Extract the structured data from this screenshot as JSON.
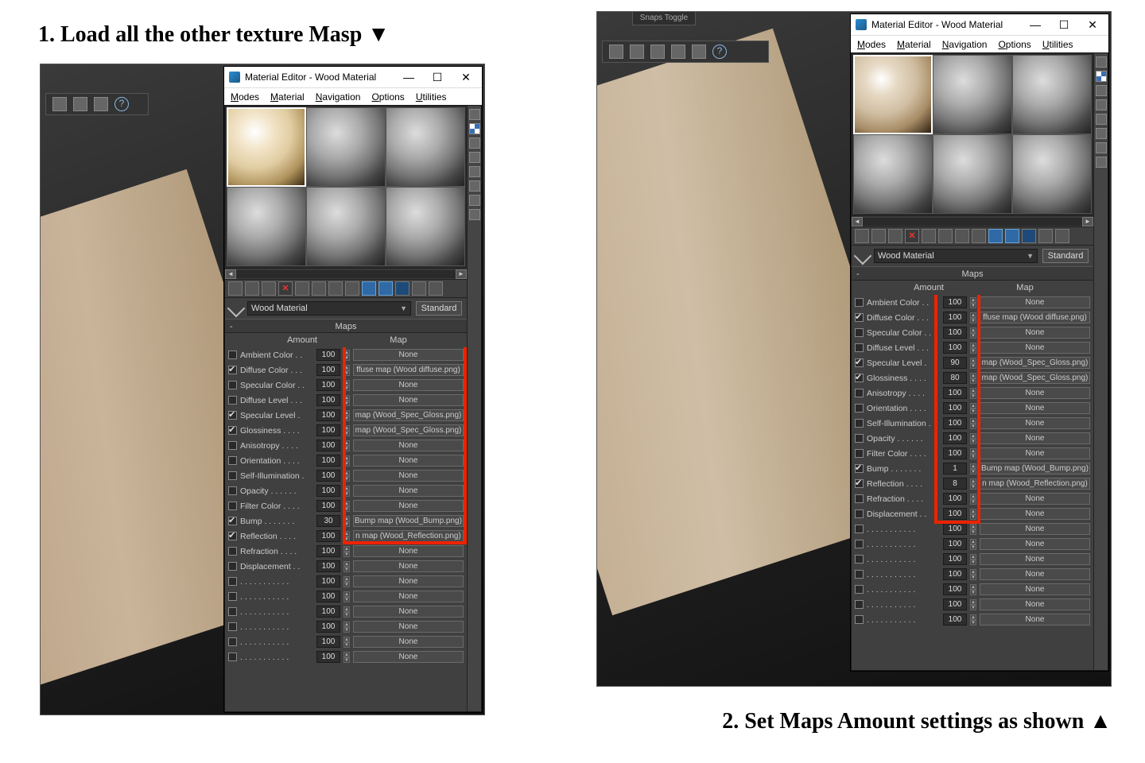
{
  "step1_label": "1. Load all the other texture Masp ▼",
  "step2_label": "2. Set Maps Amount settings as shown ▲",
  "snaps_label": "Snaps Toggle",
  "me_title": "Material Editor - Wood Material",
  "menu": {
    "modes": "Modes",
    "material": "Material",
    "navigation": "Navigation",
    "options": "Options",
    "utilities": "Utilities"
  },
  "material_name": "Wood Material",
  "shader_button": "Standard",
  "rollout_title": "Maps",
  "col_amount": "Amount",
  "col_map": "Map",
  "rows_left": [
    {
      "chk": false,
      "label": "Ambient Color . .",
      "amt": "100",
      "map": "None"
    },
    {
      "chk": true,
      "label": "Diffuse Color . . .",
      "amt": "100",
      "map": "ffuse map (Wood diffuse.png)"
    },
    {
      "chk": false,
      "label": "Specular Color . .",
      "amt": "100",
      "map": "None"
    },
    {
      "chk": false,
      "label": "Diffuse Level . . .",
      "amt": "100",
      "map": "None"
    },
    {
      "chk": true,
      "label": "Specular Level .",
      "amt": "100",
      "map": "map (Wood_Spec_Gloss.png)"
    },
    {
      "chk": true,
      "label": "Glossiness  . . . .",
      "amt": "100",
      "map": "map (Wood_Spec_Gloss.png)"
    },
    {
      "chk": false,
      "label": "Anisotropy . . . .",
      "amt": "100",
      "map": "None"
    },
    {
      "chk": false,
      "label": "Orientation . . . .",
      "amt": "100",
      "map": "None"
    },
    {
      "chk": false,
      "label": "Self-Illumination .",
      "amt": "100",
      "map": "None"
    },
    {
      "chk": false,
      "label": "Opacity . . . . . .",
      "amt": "100",
      "map": "None"
    },
    {
      "chk": false,
      "label": "Filter Color . . . .",
      "amt": "100",
      "map": "None"
    },
    {
      "chk": true,
      "label": "Bump . . . . . . .",
      "amt": "30",
      "map": "Bump map (Wood_Bump.png)"
    },
    {
      "chk": true,
      "label": "Reflection  . . . .",
      "amt": "100",
      "map": "n map (Wood_Reflection.png)"
    },
    {
      "chk": false,
      "label": "Refraction  . . . .",
      "amt": "100",
      "map": "None"
    },
    {
      "chk": false,
      "label": "Displacement  . .",
      "amt": "100",
      "map": "None"
    },
    {
      "chk": false,
      "label": " . . . . . . . . . . .",
      "amt": "100",
      "map": "None"
    },
    {
      "chk": false,
      "label": " . . . . . . . . . . .",
      "amt": "100",
      "map": "None"
    },
    {
      "chk": false,
      "label": " . . . . . . . . . . .",
      "amt": "100",
      "map": "None"
    },
    {
      "chk": false,
      "label": " . . . . . . . . . . .",
      "amt": "100",
      "map": "None"
    },
    {
      "chk": false,
      "label": " . . . . . . . . . . .",
      "amt": "100",
      "map": "None"
    },
    {
      "chk": false,
      "label": " . . . . . . . . . . .",
      "amt": "100",
      "map": "None"
    }
  ],
  "rows_right": [
    {
      "chk": false,
      "label": "Ambient Color . .",
      "amt": "100",
      "map": "None"
    },
    {
      "chk": true,
      "label": "Diffuse Color . . .",
      "amt": "100",
      "map": "ffuse map (Wood diffuse.png)"
    },
    {
      "chk": false,
      "label": "Specular Color . .",
      "amt": "100",
      "map": "None"
    },
    {
      "chk": false,
      "label": "Diffuse Level . . .",
      "amt": "100",
      "map": "None"
    },
    {
      "chk": true,
      "label": "Specular Level .",
      "amt": "90",
      "map": "map (Wood_Spec_Gloss.png)"
    },
    {
      "chk": true,
      "label": "Glossiness  . . . .",
      "amt": "80",
      "map": "map (Wood_Spec_Gloss.png)"
    },
    {
      "chk": false,
      "label": "Anisotropy . . . .",
      "amt": "100",
      "map": "None"
    },
    {
      "chk": false,
      "label": "Orientation . . . .",
      "amt": "100",
      "map": "None"
    },
    {
      "chk": false,
      "label": "Self-Illumination .",
      "amt": "100",
      "map": "None"
    },
    {
      "chk": false,
      "label": "Opacity . . . . . .",
      "amt": "100",
      "map": "None"
    },
    {
      "chk": false,
      "label": "Filter Color . . . .",
      "amt": "100",
      "map": "None"
    },
    {
      "chk": true,
      "label": "Bump . . . . . . .",
      "amt": "1",
      "map": "Bump map (Wood_Bump.png)"
    },
    {
      "chk": true,
      "label": "Reflection  . . . .",
      "amt": "8",
      "map": "n map (Wood_Reflection.png)"
    },
    {
      "chk": false,
      "label": "Refraction  . . . .",
      "amt": "100",
      "map": "None"
    },
    {
      "chk": false,
      "label": "Displacement  . .",
      "amt": "100",
      "map": "None"
    },
    {
      "chk": false,
      "label": " . . . . . . . . . . .",
      "amt": "100",
      "map": "None"
    },
    {
      "chk": false,
      "label": " . . . . . . . . . . .",
      "amt": "100",
      "map": "None"
    },
    {
      "chk": false,
      "label": " . . . . . . . . . . .",
      "amt": "100",
      "map": "None"
    },
    {
      "chk": false,
      "label": " . . . . . . . . . . .",
      "amt": "100",
      "map": "None"
    },
    {
      "chk": false,
      "label": " . . . . . . . . . . .",
      "amt": "100",
      "map": "None"
    },
    {
      "chk": false,
      "label": " . . . . . . . . . . .",
      "amt": "100",
      "map": "None"
    },
    {
      "chk": false,
      "label": " . . . . . . . . . . .",
      "amt": "100",
      "map": "None"
    }
  ]
}
